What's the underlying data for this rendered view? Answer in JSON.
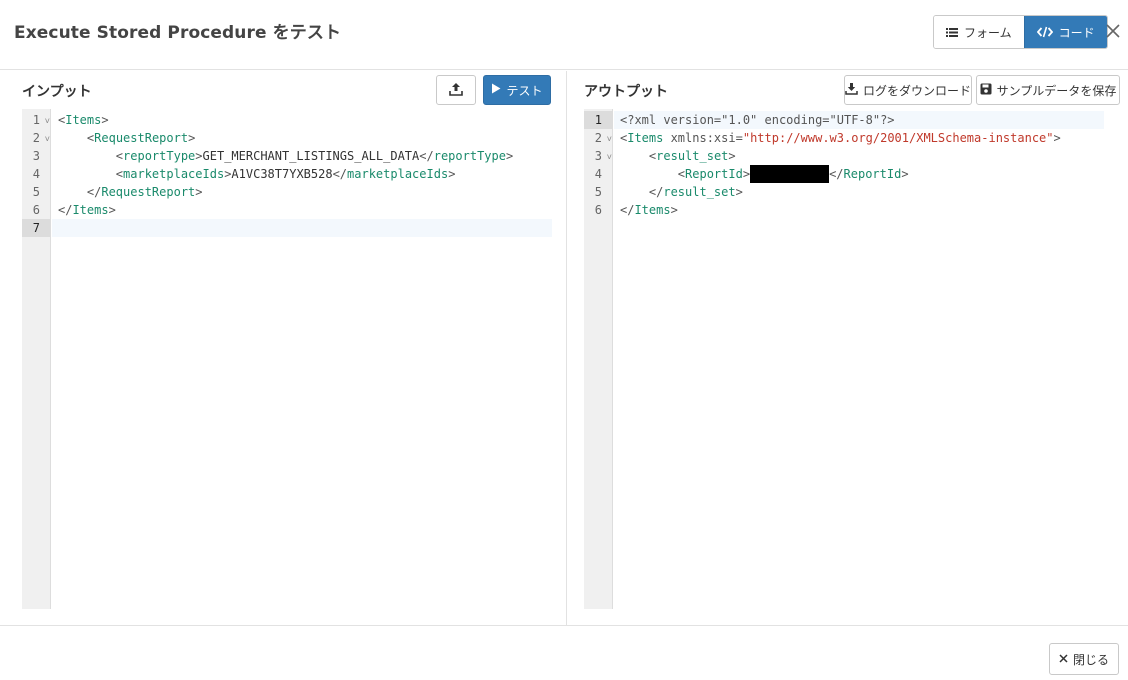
{
  "header": {
    "title": "Execute Stored Procedure をテスト",
    "form_label": "フォーム",
    "code_label": "コード",
    "active_view": "code"
  },
  "input_panel": {
    "title": "インプット",
    "test_label": "テスト",
    "lines": [
      {
        "num": "1",
        "fold": true,
        "parts": [
          [
            "punct",
            "<"
          ],
          [
            "tag",
            "Items"
          ],
          [
            "punct",
            ">"
          ]
        ]
      },
      {
        "num": "2",
        "fold": true,
        "parts": [
          [
            "txt",
            "    "
          ],
          [
            "punct",
            "<"
          ],
          [
            "tag",
            "RequestReport"
          ],
          [
            "punct",
            ">"
          ]
        ]
      },
      {
        "num": "3",
        "fold": false,
        "parts": [
          [
            "txt",
            "        "
          ],
          [
            "punct",
            "<"
          ],
          [
            "tag",
            "reportType"
          ],
          [
            "punct",
            ">"
          ],
          [
            "txt",
            "GET_MERCHANT_LISTINGS_ALL_DATA"
          ],
          [
            "punct",
            "</"
          ],
          [
            "tag",
            "reportType"
          ],
          [
            "punct",
            ">"
          ]
        ]
      },
      {
        "num": "4",
        "fold": false,
        "parts": [
          [
            "txt",
            "        "
          ],
          [
            "punct",
            "<"
          ],
          [
            "tag",
            "marketplaceIds"
          ],
          [
            "punct",
            ">"
          ],
          [
            "txt",
            "A1VC38T7YXB528"
          ],
          [
            "punct",
            "</"
          ],
          [
            "tag",
            "marketplaceIds"
          ],
          [
            "punct",
            ">"
          ]
        ]
      },
      {
        "num": "5",
        "fold": false,
        "parts": [
          [
            "txt",
            "    "
          ],
          [
            "punct",
            "</"
          ],
          [
            "tag",
            "RequestReport"
          ],
          [
            "punct",
            ">"
          ]
        ]
      },
      {
        "num": "6",
        "fold": false,
        "parts": [
          [
            "punct",
            "</"
          ],
          [
            "tag",
            "Items"
          ],
          [
            "punct",
            ">"
          ]
        ]
      },
      {
        "num": "7",
        "fold": false,
        "parts": []
      }
    ],
    "active_line": 6
  },
  "output_panel": {
    "title": "アウトプット",
    "download_log_label": "ログをダウンロード",
    "save_sample_label": "サンプルデータを保存",
    "lines": [
      {
        "num": "1",
        "fold": false,
        "parts": [
          [
            "punct",
            "<?xml version=\"1.0\" encoding=\"UTF-8\"?>"
          ]
        ]
      },
      {
        "num": "2",
        "fold": true,
        "parts": [
          [
            "punct",
            "<"
          ],
          [
            "tag",
            "Items"
          ],
          [
            "attr",
            " xmlns:xsi="
          ],
          [
            "str",
            "\"http://www.w3.org/2001/XMLSchema-instance\""
          ],
          [
            "punct",
            ">"
          ]
        ]
      },
      {
        "num": "3",
        "fold": true,
        "parts": [
          [
            "txt",
            "    "
          ],
          [
            "punct",
            "<"
          ],
          [
            "tag",
            "result_set"
          ],
          [
            "punct",
            ">"
          ]
        ]
      },
      {
        "num": "4",
        "fold": false,
        "parts": [
          [
            "txt",
            "        "
          ],
          [
            "punct",
            "<"
          ],
          [
            "tag",
            "ReportId"
          ],
          [
            "punct",
            ">"
          ],
          [
            "redact",
            ""
          ],
          [
            "punct",
            "</"
          ],
          [
            "tag",
            "ReportId"
          ],
          [
            "punct",
            ">"
          ]
        ]
      },
      {
        "num": "5",
        "fold": false,
        "parts": [
          [
            "txt",
            "    "
          ],
          [
            "punct",
            "</"
          ],
          [
            "tag",
            "result_set"
          ],
          [
            "punct",
            ">"
          ]
        ]
      },
      {
        "num": "6",
        "fold": false,
        "parts": [
          [
            "punct",
            "</"
          ],
          [
            "tag",
            "Items"
          ],
          [
            "punct",
            ">"
          ]
        ]
      }
    ],
    "active_line": 0
  },
  "footer": {
    "close_label": "閉じる"
  },
  "colors": {
    "primary": "#337ab7",
    "tag": "#1a8a6b",
    "string": "#c0392b"
  },
  "icons": {
    "form": "list-icon",
    "code": "code-icon",
    "close": "close-icon",
    "upload": "upload-icon",
    "test": "play-icon",
    "download": "download-icon",
    "save": "save-icon"
  }
}
